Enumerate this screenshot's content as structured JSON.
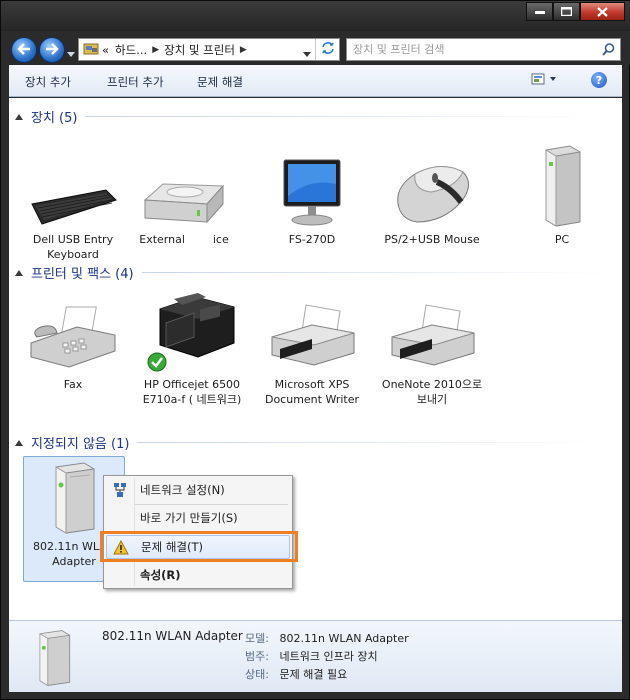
{
  "window": {
    "caption_buttons": [
      "minimize-icon",
      "maximize-icon",
      "close-icon"
    ]
  },
  "address_bar": {
    "overflow": "«",
    "crumbs": [
      "하드...",
      "장치 및 프린터"
    ],
    "search_placeholder": "장치 및 프린터 검색"
  },
  "toolbar": {
    "add_device": "장치 추가",
    "add_printer": "프린터 추가",
    "troubleshoot": "문제 해결",
    "help": "?"
  },
  "groups": [
    {
      "title": "장치 (5)",
      "items": [
        {
          "label": "Dell USB Entry Keyboard",
          "icon": "keyboard-icon"
        },
        {
          "label": "External        ice",
          "icon": "external-drive-icon"
        },
        {
          "label": "FS-270D",
          "icon": "monitor-icon"
        },
        {
          "label": "PS/2+USB Mouse",
          "icon": "mouse-icon"
        },
        {
          "label": "PC",
          "icon": "pc-tower-icon"
        }
      ]
    },
    {
      "title": "프린터 및 팩스 (4)",
      "items": [
        {
          "label": "Fax",
          "icon": "fax-icon"
        },
        {
          "label": "HP Officejet 6500 E710a-f ( 네트워크)",
          "icon": "printer-icon",
          "default": true
        },
        {
          "label": "Microsoft XPS Document Writer",
          "icon": "printer-icon"
        },
        {
          "label": "OneNote 2010으로 보내기",
          "icon": "printer-icon"
        }
      ]
    },
    {
      "title": "지정되지 않음 (1)",
      "items": [
        {
          "label": "802.11n WLAN Adapter",
          "icon": "network-adapter-icon",
          "selected": true
        }
      ]
    }
  ],
  "context_menu": {
    "items": [
      {
        "label": "네트워크 설정(N)",
        "icon": "network-settings-icon"
      },
      {
        "label": "바로 가기 만들기(S)",
        "icon": ""
      },
      {
        "label": "문제 해결(T)",
        "icon": "warning-icon",
        "highlighted": true
      },
      {
        "label": "속성(R)",
        "icon": "",
        "bold": true
      }
    ]
  },
  "details": {
    "name": "802.11n WLAN Adapter",
    "rows": [
      {
        "key": "모델:",
        "value": "802.11n WLAN Adapter"
      },
      {
        "key": "범주:",
        "value": "네트워크 인프라 장치"
      },
      {
        "key": "상태:",
        "value": "문제 해결 필요"
      }
    ]
  },
  "colors": {
    "group_title": "#1e3287",
    "highlight_box": "#f07f22"
  }
}
